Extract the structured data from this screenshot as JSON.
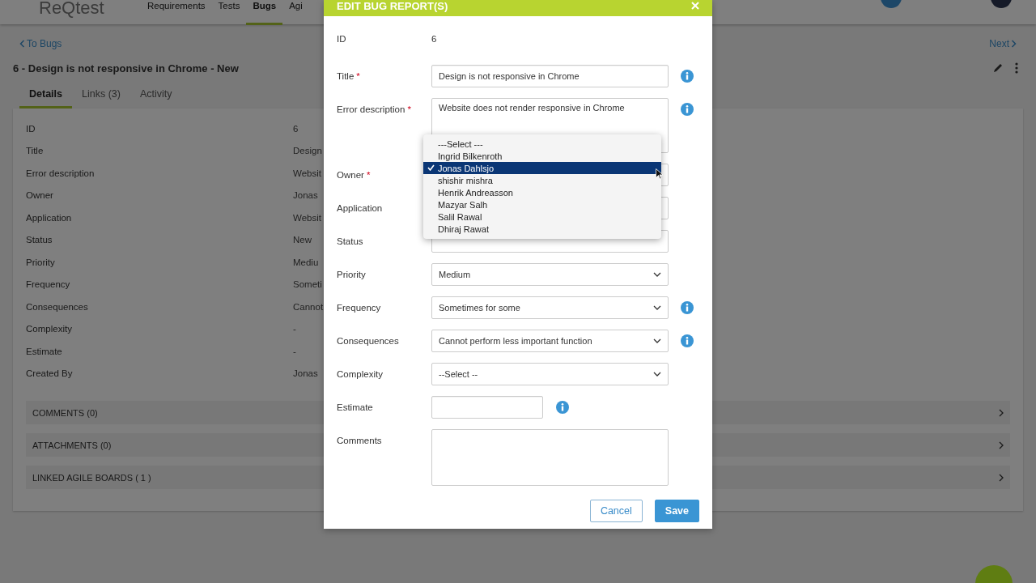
{
  "app": {
    "logo": "ReQtest",
    "nav": [
      {
        "label": "Requirements",
        "selected": false
      },
      {
        "label": "Tests",
        "selected": false
      },
      {
        "label": "Bugs",
        "selected": true
      },
      {
        "label": "Agi",
        "selected": false
      }
    ]
  },
  "back_link": "To Bugs",
  "next_link": "Next",
  "bug_title": "6 - Design is not responsive in Chrome - New",
  "tabs": [
    {
      "label": "Details",
      "selected": true
    },
    {
      "label": "Links (3)",
      "selected": false
    },
    {
      "label": "Activity",
      "selected": false
    }
  ],
  "details": [
    {
      "label": "ID",
      "value": "6"
    },
    {
      "label": "Title",
      "value": "Design"
    },
    {
      "label": "Error description",
      "value": "Websit"
    },
    {
      "label": "Owner",
      "value": "Jonas"
    },
    {
      "label": "Application",
      "value": "Websit"
    },
    {
      "label": "Status",
      "value": "New"
    },
    {
      "label": "Priority",
      "value": "Mediu"
    },
    {
      "label": "Frequency",
      "value": "Someti"
    },
    {
      "label": "Consequences",
      "value": "Cannot"
    },
    {
      "label": "Complexity",
      "value": "-"
    },
    {
      "label": "Estimate",
      "value": "-"
    },
    {
      "label": "Created By",
      "value": "Jonas"
    }
  ],
  "sections": [
    "COMMENTS (0)",
    "ATTACHMENTS (0)",
    "LINKED AGILE BOARDS ( 1 )"
  ],
  "dialog": {
    "title": "EDIT BUG REPORT(S)",
    "required_mark": "*",
    "fields": [
      {
        "label": "ID",
        "kind": "static",
        "required": false,
        "value": "6",
        "info": false
      },
      {
        "label": "Title",
        "kind": "text",
        "required": true,
        "value": "Design is not responsive in Chrome",
        "info": true
      },
      {
        "label": "Error description",
        "kind": "textarea",
        "required": true,
        "value": "Website does not render responsive in Chrome",
        "info": true
      },
      {
        "label": "Owner",
        "kind": "select",
        "required": true,
        "info": false
      },
      {
        "label": "Application",
        "kind": "select",
        "required": false,
        "info": false
      },
      {
        "label": "Status",
        "kind": "select",
        "required": false,
        "info": false
      },
      {
        "label": "Priority",
        "kind": "select",
        "required": false,
        "value": "Medium",
        "info": false
      },
      {
        "label": "Frequency",
        "kind": "select",
        "required": false,
        "value": "Sometimes for some",
        "info": true
      },
      {
        "label": "Consequences",
        "kind": "select",
        "required": false,
        "value": "Cannot perform less important function",
        "info": true
      },
      {
        "label": "Complexity",
        "kind": "select",
        "required": false,
        "value": "--Select --",
        "info": false
      },
      {
        "label": "Estimate",
        "kind": "short",
        "required": false,
        "info": true
      },
      {
        "label": "Comments",
        "kind": "textarea",
        "required": false,
        "info": false
      }
    ],
    "owner_options": [
      {
        "label": "---Select ---",
        "selected": false
      },
      {
        "label": "Ingrid Bilkenroth",
        "selected": false
      },
      {
        "label": "Jonas Dahlsjo",
        "selected": true
      },
      {
        "label": "shishir mishra",
        "selected": false
      },
      {
        "label": "Henrik Andreasson",
        "selected": false
      },
      {
        "label": "Mazyar Salh",
        "selected": false
      },
      {
        "label": "Salil Rawal",
        "selected": false
      },
      {
        "label": "Dhiraj Rawat",
        "selected": false
      }
    ],
    "buttons": [
      {
        "label": "Cancel",
        "kind": "secondary"
      },
      {
        "label": "Save",
        "kind": "primary"
      }
    ]
  }
}
